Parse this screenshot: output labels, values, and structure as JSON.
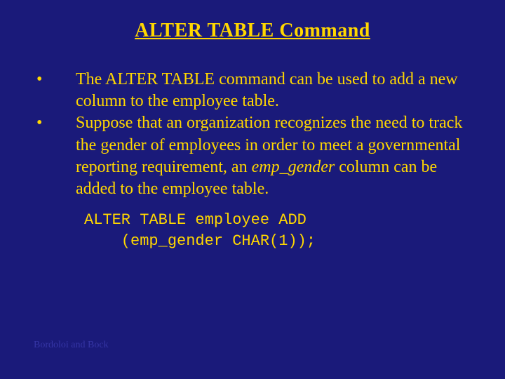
{
  "title": "ALTER TABLE Command",
  "bullets": [
    {
      "mark": "•",
      "text": "The ALTER TABLE command can be used to add a new column to the employee table."
    },
    {
      "mark": "•",
      "text_pre": "Suppose that an organization recognizes the need to track the gender of employees in order to meet a governmental reporting requirement, an ",
      "text_italic": "emp_gender",
      "text_post": " column can be added to the employee table."
    }
  ],
  "code": {
    "line1": "ALTER TABLE employee ADD",
    "line2_indent": "    (emp_gender CHAR(1));"
  },
  "footer": "Bordoloi and Bock"
}
